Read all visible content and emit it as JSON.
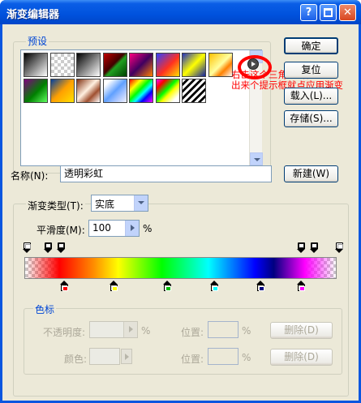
{
  "window": {
    "title": "渐变编辑器"
  },
  "presets": {
    "label": "预设",
    "swatches": [
      "linear-gradient(135deg,#000,#fff)",
      "repeating-conic-gradient(#ccc 0 25%,#fff 0 50%) 0 0/8px 8px",
      "linear-gradient(135deg,#000 0%,#fff 100%)",
      "linear-gradient(135deg,#c00000,#400000 45%,#20a020 55%,#004000)",
      "linear-gradient(135deg,#ff0080,#400060 50%,#ff8000)",
      "linear-gradient(135deg,#3040ff,#ff3020 55%,#ffe000)",
      "linear-gradient(135deg,#2030c0 0%,#ffff00 50%,#1020a0 100%)",
      "linear-gradient(135deg,#ffc000,#ffffa0 50%,#ff8000 70%,#fff)",
      "linear-gradient(135deg,#800080,#008000 55%,#60ff60)",
      "linear-gradient(135deg,#0040a0,#ffa000 50%,#ffe000)",
      "linear-gradient(135deg,#803010,#fff0e0 45%,#a05030 70%,#fff)",
      "linear-gradient(135deg,#fff 15%,#60a0ff 50%,#a0c0ff 70%,#f0f0ff)",
      "linear-gradient(135deg,#ff0000,#ffff00 25%,#00ff00 45%,#00ffff 60%,#0000ff 75%,#ff00ff)",
      "linear-gradient(135deg,#ff00ff 0%,#ff0000 20%,#00ff00 45%,#ffff00 60%,#ffffff 85%)",
      "repeating-linear-gradient(135deg,#fff 0 3px,#000 3px 6px)"
    ]
  },
  "annotation": {
    "line1": "右击这个三角-色谱",
    "line2": "出来个提示框就点应用渐变"
  },
  "buttons": {
    "ok": "确定",
    "reset": "复位",
    "load": "载入(L)...",
    "save": "存储(S)...",
    "new": "新建(W)"
  },
  "name_field": {
    "label": "名称(N):",
    "value": "透明彩虹"
  },
  "gradient_type": {
    "label": "渐变类型(T):",
    "value": "实底"
  },
  "smoothness": {
    "label": "平滑度(M):",
    "value": "100",
    "unit": "%"
  },
  "color_stops": {
    "group_label": "色标",
    "opacity_label": "不透明度:",
    "opacity_unit": "%",
    "location_label_1": "位置:",
    "location_unit_1": "%",
    "delete_label_1": "删除(D)",
    "color_label": "颜色:",
    "location_label_2": "位置:",
    "location_unit_2": "%",
    "delete_label_2": "删除(D)"
  },
  "gradient": {
    "opacity_stops": [
      0,
      7,
      11,
      88,
      92,
      100
    ],
    "color_stops": [
      {
        "pos": 12,
        "color": "#ff0000"
      },
      {
        "pos": 28,
        "color": "#ffff00"
      },
      {
        "pos": 45,
        "color": "#00c000"
      },
      {
        "pos": 60,
        "color": "#00ffff"
      },
      {
        "pos": 75,
        "color": "#000080"
      },
      {
        "pos": 88,
        "color": "#ff00ff"
      }
    ]
  }
}
